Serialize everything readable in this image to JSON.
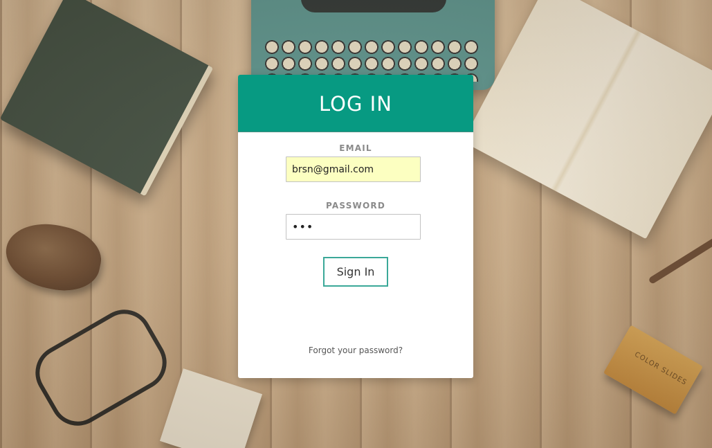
{
  "login": {
    "title": "LOG IN",
    "email_label": "EMAIL",
    "email_value": "brsn@gmail.com",
    "password_label": "PASSWORD",
    "password_value": "abc",
    "signin_label": "Sign In",
    "forgot_label": "Forgot your password?"
  },
  "background": {
    "slides_box_text": "COLOR SLIDES"
  },
  "colors": {
    "header": "#079a82",
    "button_border": "#3aa898",
    "email_autofill_bg": "#fcffc1"
  }
}
